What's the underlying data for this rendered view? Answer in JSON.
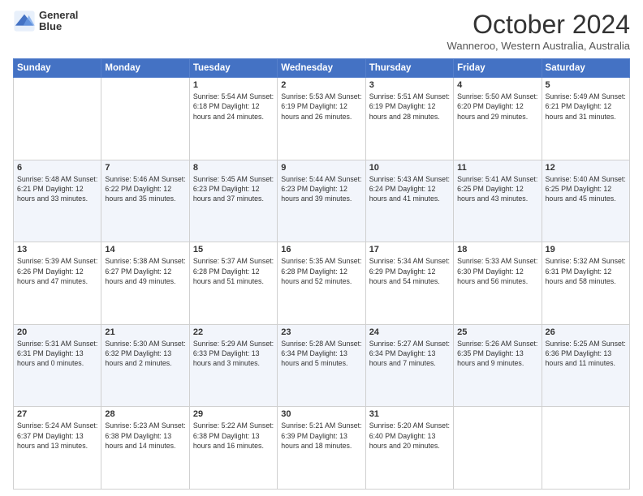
{
  "header": {
    "logo_line1": "General",
    "logo_line2": "Blue",
    "title": "October 2024",
    "subtitle": "Wanneroo, Western Australia, Australia"
  },
  "days_of_week": [
    "Sunday",
    "Monday",
    "Tuesday",
    "Wednesday",
    "Thursday",
    "Friday",
    "Saturday"
  ],
  "weeks": [
    [
      {
        "day": "",
        "info": ""
      },
      {
        "day": "",
        "info": ""
      },
      {
        "day": "1",
        "info": "Sunrise: 5:54 AM\nSunset: 6:18 PM\nDaylight: 12 hours and 24 minutes."
      },
      {
        "day": "2",
        "info": "Sunrise: 5:53 AM\nSunset: 6:19 PM\nDaylight: 12 hours and 26 minutes."
      },
      {
        "day": "3",
        "info": "Sunrise: 5:51 AM\nSunset: 6:19 PM\nDaylight: 12 hours and 28 minutes."
      },
      {
        "day": "4",
        "info": "Sunrise: 5:50 AM\nSunset: 6:20 PM\nDaylight: 12 hours and 29 minutes."
      },
      {
        "day": "5",
        "info": "Sunrise: 5:49 AM\nSunset: 6:21 PM\nDaylight: 12 hours and 31 minutes."
      }
    ],
    [
      {
        "day": "6",
        "info": "Sunrise: 5:48 AM\nSunset: 6:21 PM\nDaylight: 12 hours and 33 minutes."
      },
      {
        "day": "7",
        "info": "Sunrise: 5:46 AM\nSunset: 6:22 PM\nDaylight: 12 hours and 35 minutes."
      },
      {
        "day": "8",
        "info": "Sunrise: 5:45 AM\nSunset: 6:23 PM\nDaylight: 12 hours and 37 minutes."
      },
      {
        "day": "9",
        "info": "Sunrise: 5:44 AM\nSunset: 6:23 PM\nDaylight: 12 hours and 39 minutes."
      },
      {
        "day": "10",
        "info": "Sunrise: 5:43 AM\nSunset: 6:24 PM\nDaylight: 12 hours and 41 minutes."
      },
      {
        "day": "11",
        "info": "Sunrise: 5:41 AM\nSunset: 6:25 PM\nDaylight: 12 hours and 43 minutes."
      },
      {
        "day": "12",
        "info": "Sunrise: 5:40 AM\nSunset: 6:25 PM\nDaylight: 12 hours and 45 minutes."
      }
    ],
    [
      {
        "day": "13",
        "info": "Sunrise: 5:39 AM\nSunset: 6:26 PM\nDaylight: 12 hours and 47 minutes."
      },
      {
        "day": "14",
        "info": "Sunrise: 5:38 AM\nSunset: 6:27 PM\nDaylight: 12 hours and 49 minutes."
      },
      {
        "day": "15",
        "info": "Sunrise: 5:37 AM\nSunset: 6:28 PM\nDaylight: 12 hours and 51 minutes."
      },
      {
        "day": "16",
        "info": "Sunrise: 5:35 AM\nSunset: 6:28 PM\nDaylight: 12 hours and 52 minutes."
      },
      {
        "day": "17",
        "info": "Sunrise: 5:34 AM\nSunset: 6:29 PM\nDaylight: 12 hours and 54 minutes."
      },
      {
        "day": "18",
        "info": "Sunrise: 5:33 AM\nSunset: 6:30 PM\nDaylight: 12 hours and 56 minutes."
      },
      {
        "day": "19",
        "info": "Sunrise: 5:32 AM\nSunset: 6:31 PM\nDaylight: 12 hours and 58 minutes."
      }
    ],
    [
      {
        "day": "20",
        "info": "Sunrise: 5:31 AM\nSunset: 6:31 PM\nDaylight: 13 hours and 0 minutes."
      },
      {
        "day": "21",
        "info": "Sunrise: 5:30 AM\nSunset: 6:32 PM\nDaylight: 13 hours and 2 minutes."
      },
      {
        "day": "22",
        "info": "Sunrise: 5:29 AM\nSunset: 6:33 PM\nDaylight: 13 hours and 3 minutes."
      },
      {
        "day": "23",
        "info": "Sunrise: 5:28 AM\nSunset: 6:34 PM\nDaylight: 13 hours and 5 minutes."
      },
      {
        "day": "24",
        "info": "Sunrise: 5:27 AM\nSunset: 6:34 PM\nDaylight: 13 hours and 7 minutes."
      },
      {
        "day": "25",
        "info": "Sunrise: 5:26 AM\nSunset: 6:35 PM\nDaylight: 13 hours and 9 minutes."
      },
      {
        "day": "26",
        "info": "Sunrise: 5:25 AM\nSunset: 6:36 PM\nDaylight: 13 hours and 11 minutes."
      }
    ],
    [
      {
        "day": "27",
        "info": "Sunrise: 5:24 AM\nSunset: 6:37 PM\nDaylight: 13 hours and 13 minutes."
      },
      {
        "day": "28",
        "info": "Sunrise: 5:23 AM\nSunset: 6:38 PM\nDaylight: 13 hours and 14 minutes."
      },
      {
        "day": "29",
        "info": "Sunrise: 5:22 AM\nSunset: 6:38 PM\nDaylight: 13 hours and 16 minutes."
      },
      {
        "day": "30",
        "info": "Sunrise: 5:21 AM\nSunset: 6:39 PM\nDaylight: 13 hours and 18 minutes."
      },
      {
        "day": "31",
        "info": "Sunrise: 5:20 AM\nSunset: 6:40 PM\nDaylight: 13 hours and 20 minutes."
      },
      {
        "day": "",
        "info": ""
      },
      {
        "day": "",
        "info": ""
      }
    ]
  ]
}
